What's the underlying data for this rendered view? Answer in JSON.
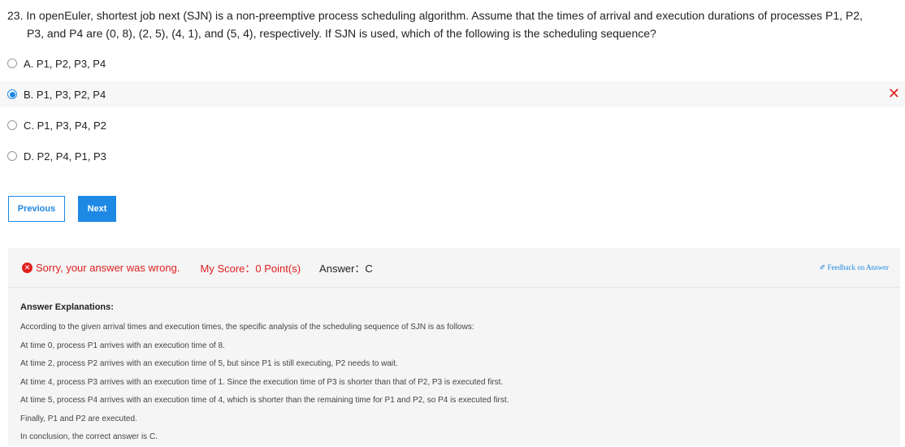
{
  "question": {
    "number": "23.",
    "text_line1": "In openEuler, shortest job next (SJN) is a non-preemptive process scheduling algorithm. Assume that the times of arrival and execution durations of processes P1, P2,",
    "text_line2": "P3, and P4 are (0, 8), (2, 5), (4, 1), and (5, 4), respectively. If SJN is used, which of the following is the scheduling sequence?"
  },
  "options": [
    {
      "label": "A. P1, P2, P3, P4"
    },
    {
      "label": "B. P1, P3, P2, P4"
    },
    {
      "label": "C. P1, P3, P4, P2"
    },
    {
      "label": "D. P2, P4, P1, P3"
    }
  ],
  "selected_option_index": 1,
  "wrong_mark": "✕",
  "nav": {
    "previous": "Previous",
    "next": "Next"
  },
  "result": {
    "error_icon": "✕",
    "message": "Sorry, your answer was wrong.",
    "score": "My Score：0 Point(s)",
    "answer": "Answer：C",
    "feedback": "✐ Feedback on Answer"
  },
  "explanation": {
    "title": "Answer Explanations:",
    "lines": [
      "According to the given arrival times and execution times, the specific analysis of the scheduling sequence of SJN is as follows:",
      "At time 0, process P1 arrives with an execution time of 8.",
      "At time 2, process P2 arrives with an execution time of 5, but since P1 is still executing, P2 needs to wait.",
      "At time 4, process P3 arrives with an execution time of 1. Since the execution time of P3 is shorter than that of P2, P3 is executed first.",
      "At time 5, process P4 arrives with an execution time of 4, which is shorter than the remaining time for P1 and P2, so P4 is executed first.",
      "Finally, P1 and P2 are executed.",
      "In conclusion, the correct answer is C."
    ]
  },
  "colors": {
    "accent": "#1e88e5",
    "error": "#e02020"
  }
}
